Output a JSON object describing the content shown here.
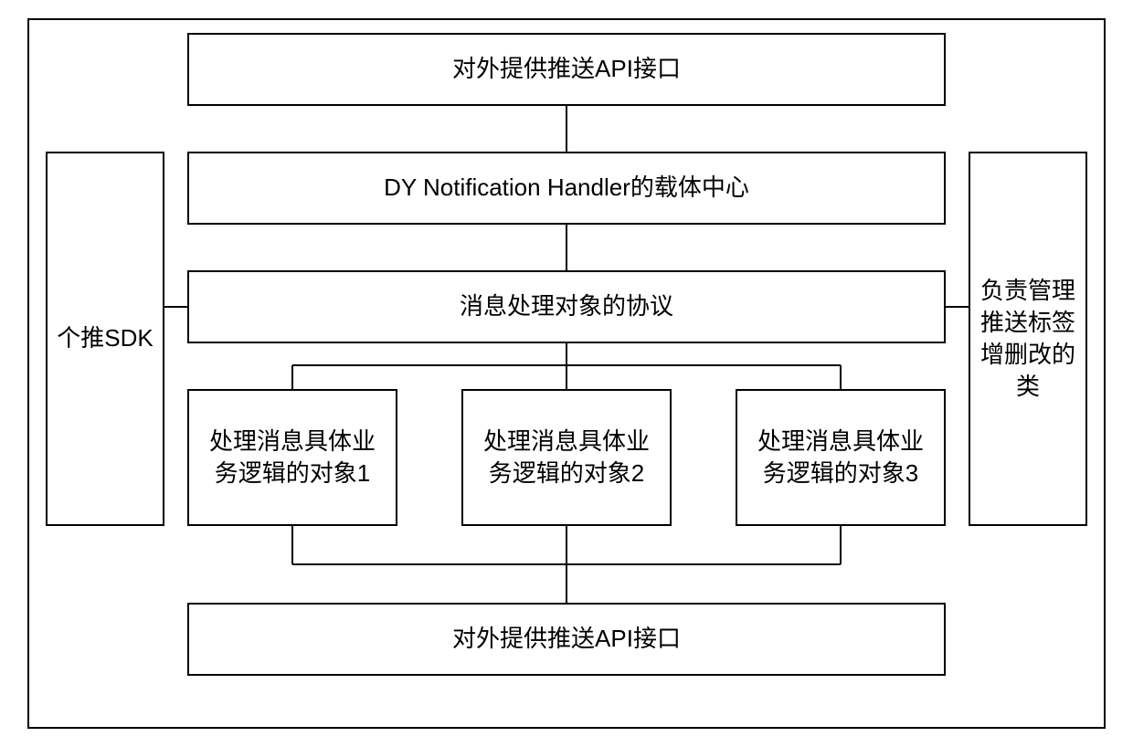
{
  "diagram": {
    "top_api": "对外提供推送API接口",
    "handler_center": "DY Notification Handler的载体中心",
    "protocol": "消息处理对象的协议",
    "left_sdk": "个推SDK",
    "right_mgr": "负责管理推送标签增删改的类",
    "handler1": "处理消息具体业务逻辑的对象1",
    "handler2": "处理消息具体业务逻辑的对象2",
    "handler3": "处理消息具体业务逻辑的对象3",
    "bottom_api": "对外提供推送API接口"
  }
}
